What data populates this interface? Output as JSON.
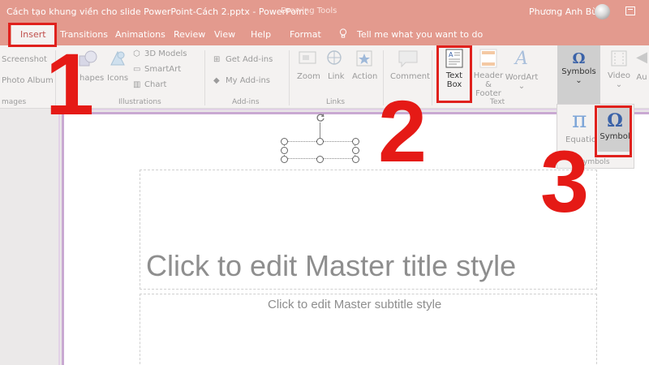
{
  "titlebar": {
    "document_title": "Cách tạo khung viền cho slide PowerPoint-Cách 2.pptx  -  PowerPoint",
    "contextual_tools": "Drawing Tools",
    "user_name": "Phương Anh Bùi",
    "accent_color": "#e39a8e"
  },
  "tabs": {
    "insert": "Insert",
    "transitions": "Transitions",
    "animations": "Animations",
    "review": "Review",
    "view": "View",
    "help": "Help",
    "format": "Format",
    "tell_me": "Tell me what you want to do"
  },
  "ribbon": {
    "images": {
      "screenshot": "Screenshot",
      "photo_album": "Photo Album",
      "group": "mages"
    },
    "illustrations": {
      "shapes": "hapes",
      "icons": "Icons",
      "models": "3D Models",
      "smartart": "SmartArt",
      "chart": "Chart",
      "group": "Illustrations"
    },
    "addins": {
      "get": "Get Add-ins",
      "my": "My Add-ins",
      "group": "Add-ins"
    },
    "links": {
      "zoom": "Zoom",
      "link": "Link",
      "action": "Action",
      "group": "Links"
    },
    "comments": {
      "comment": "Comment"
    },
    "text": {
      "textbox_line1": "Text",
      "textbox_line2": "Box",
      "header_line1": "Header",
      "header_line2": "& Footer",
      "wordart": "WordArt",
      "group": "Text"
    },
    "symbols": {
      "label": "Symbols",
      "chevron": "⌄"
    },
    "media": {
      "video": "Video",
      "audio": "Au"
    }
  },
  "flyout": {
    "equation": "Equatio",
    "symbol": "Symbol",
    "group": "ymbols"
  },
  "slide": {
    "title_placeholder": "Click to edit Master title style",
    "subtitle_placeholder": "Click to edit Master subtitle style"
  },
  "annotations": {
    "step1": "1",
    "step2": "2",
    "step3": "3",
    "color": "#e0211d"
  }
}
